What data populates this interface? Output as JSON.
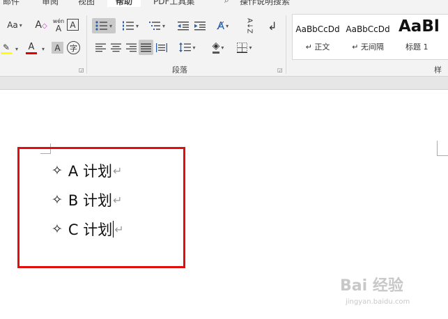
{
  "tabs": [
    {
      "label": "邮件",
      "active": false
    },
    {
      "label": "审阅",
      "active": false
    },
    {
      "label": "视图",
      "active": false
    },
    {
      "label": "帮助",
      "active": true
    },
    {
      "label": "PDF工具集",
      "active": false
    },
    {
      "label": "操作说明搜索",
      "active": false
    }
  ],
  "font_group": {
    "case_label": "Aa",
    "phonetic_label": "wén",
    "phonetic_char": "A",
    "border_char": "A",
    "highlight_char": "ab",
    "font_color_char": "A",
    "shading_char": "A",
    "enclose_char": "字",
    "highlight_color": "#ffff00",
    "font_color": "#e00000"
  },
  "paragraph_group": {
    "label": "段落",
    "sort_label": "A↓Z",
    "pilcrow": "↲"
  },
  "styles_group": {
    "label": "样式",
    "items": [
      {
        "sample": "AaBbCcDd",
        "name": "↵ 正文"
      },
      {
        "sample": "AaBbCcDd",
        "name": "↵ 无间隔"
      },
      {
        "sample": "AaBl",
        "name": "标题 1"
      }
    ]
  },
  "document": {
    "bullet_char": "✧",
    "paragraph_mark": "↵",
    "items": [
      {
        "text": "A 计划"
      },
      {
        "text": "B 计划"
      },
      {
        "text": "C 计划"
      }
    ],
    "highlight_color": "#e10e0e"
  },
  "watermark": {
    "text": "Bai 经验",
    "url_text": "jingyan.baidu.com"
  },
  "icons": {
    "search": "search-icon",
    "bullets": "bullet-list-icon",
    "numbering": "numbered-list-icon",
    "multilevel": "multilevel-list-icon"
  }
}
